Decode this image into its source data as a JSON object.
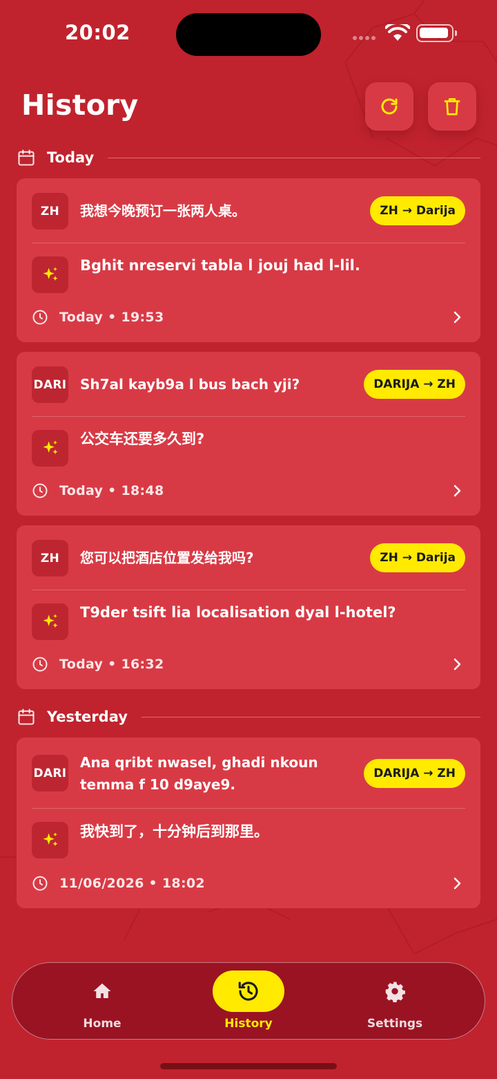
{
  "status_bar": {
    "time": "20:02"
  },
  "header": {
    "title": "History"
  },
  "sections": [
    {
      "label": "Today"
    },
    {
      "label": "Yesterday"
    }
  ],
  "cards": [
    {
      "badge": "ZH",
      "source_text": "我想今晚预订一张两人桌。",
      "direction": "ZH → Darija",
      "translation": "Bghit nreservi tabla l jouj had l-lil.",
      "timestamp": "Today • 19:53"
    },
    {
      "badge": "DARI",
      "source_text": "Sh7al kayb9a l bus bach yji?",
      "direction": "DARIJA → ZH",
      "translation": "公交车还要多久到?",
      "timestamp": "Today • 18:48"
    },
    {
      "badge": "ZH",
      "source_text": "您可以把酒店位置发给我吗?",
      "direction": "ZH → Darija",
      "translation": "T9der tsift lia localisation dyal l-hotel?",
      "timestamp": "Today • 16:32"
    },
    {
      "badge": "DARI",
      "source_text": "Ana qribt nwasel, ghadi nkoun temma f 10 d9aye9.",
      "direction": "DARIJA → ZH",
      "translation": "我快到了，十分钟后到那里。",
      "timestamp": "11/06/2026 • 18:02"
    }
  ],
  "nav": {
    "items": [
      {
        "label": "Home",
        "icon": "home-icon"
      },
      {
        "label": "History",
        "icon": "history-icon"
      },
      {
        "label": "Settings",
        "icon": "gear-icon"
      }
    ],
    "active": "History"
  },
  "colors": {
    "background": "#c0232d",
    "card": "#d83a45",
    "accent": "#ffea00",
    "nav": "#9a1323"
  }
}
